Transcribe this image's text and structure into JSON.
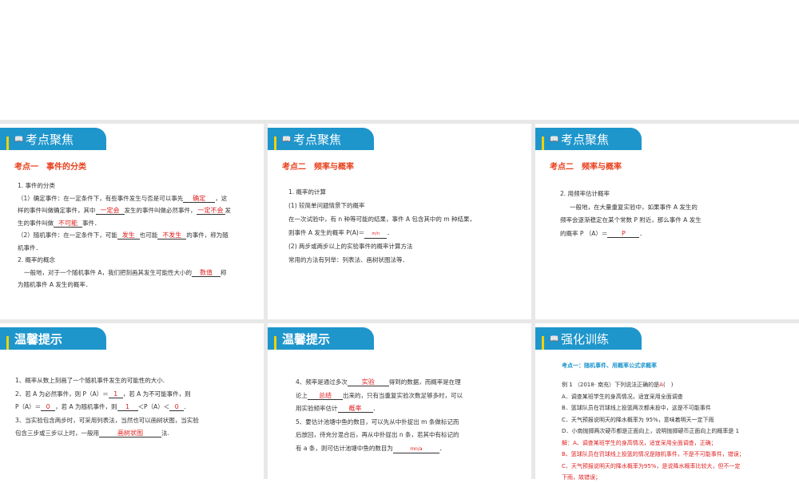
{
  "slides": [
    {
      "header": "考点聚焦",
      "subtitle": "考点一　事件的分类",
      "lines": [
        "1. 事件的分类",
        "（1）确定事件：在一定条件下，有些事件发生与否是可以事先",
        "，这",
        "样的事件叫做确定事件，其中",
        "发生的事件叫做必然事件，",
        "发",
        "生的事件叫做",
        "事件．",
        "（2）随机事件：在一定条件下，可能",
        "也可能",
        "的事件，称为随",
        "机事件．",
        "2. 概率的概念",
        "一般地，对于一个随机事件 A，我们把刻画其发生可能性大小的",
        "称",
        "为随机事件 A 发生的概率．"
      ],
      "answers": [
        "确定",
        "一定会",
        "一定不会",
        "不可能",
        "发生",
        "不发生",
        "数值"
      ]
    },
    {
      "header": "考点聚焦",
      "subtitle": "考点二　频率与概率",
      "lines": [
        "1. 概率的计算",
        "(1) 较简单问题情景下的概率",
        "在一次试验中，有 n 种等可能的结果，事件 A 包含其中的 m 种结果，",
        "则事件 A 发生的概率 P(A)＝",
        "．",
        "(2) 两步或两步以上的实验事件的概率计算方法",
        "常用的方法有列举：列表法、画树状图法等．"
      ],
      "answers": [
        "m/n"
      ]
    },
    {
      "header": "考点聚焦",
      "subtitle": "考点二　频率与概率",
      "lines": [
        "2. 用频率估计概率",
        "一般地，在大量重复实验中，如果事件 A 发生的",
        "频率会逐渐稳定在某个常数 P 附近，那么事件 A 发生",
        "的概率 P （A）＝",
        "．"
      ],
      "answers": [
        "P"
      ]
    },
    {
      "header": "温馨提示",
      "lines": [
        "1、概率从数上刻画了一个随机事件发生的可能性的大小.",
        "2、若 A 为必然事件，则 P（A）＝",
        "，若 A 为不可能事件，则",
        "P（A）＝",
        "，若 A 为随机事件，则",
        "＜P（A）＜",
        "3、当实验包含两步时，可采用列表法，当然也可以画树状图，当实验",
        "包含三步或三步以上时，一般用",
        "法."
      ],
      "answers": [
        "1",
        "0",
        "0",
        "1",
        "画树状图"
      ]
    },
    {
      "header": "温馨提示",
      "lines": [
        "4、频率是通过多次",
        "得到的数据，而概率是在理",
        "论上",
        "出来的，只有当重复实验次数足够多时，可以",
        "用实验频率估计",
        "．",
        "5、要估计池塘中鱼的数目，可以先从中扑捉出 m 条做标记而",
        "后放回，待充分混合后，再从中扑捉出 n 条，若其中有标记的",
        "有 a 条，则可估计池塘中鱼的数目为",
        "．"
      ],
      "answers": [
        "实验",
        "总结",
        "概率",
        "mn/a"
      ]
    },
    {
      "header": "强化训练",
      "subtitle": "考点一：随机事件、用概率公式求概率",
      "lines": [
        "例 1 （2018· 南充）下列说法正确的是",
        "(　)",
        "A．调查某班学生的身高情况，适宜采用全面调查",
        "B．篮球队员在罚球线上投篮两次都未投中，这是不可能事件",
        "C．天气预报说明天的降水概率为 95%，意味着明天一定下雨",
        "D．小南抛掷两次硬币都是正面向上，说明抛掷硬币正面向上的概率是 1",
        "解：A、调查某班学生的身高情况，适宜采用全面调查，正确；",
        "B、篮球队员在罚球线上投篮的情况是随机事件，不是不可能事件，错误；",
        "C、天气预报说明天的降水概率为95%，是说降水概率比较大，但不一定",
        "下雨，故错误；"
      ],
      "answers": [
        "A"
      ]
    }
  ]
}
